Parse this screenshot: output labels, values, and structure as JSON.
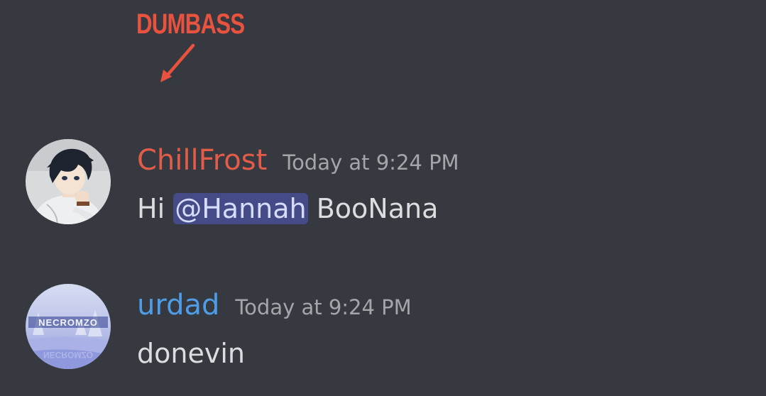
{
  "annotation": {
    "label": "DUMBASS",
    "color": "#e8523f"
  },
  "messages": [
    {
      "author": "ChillFrost",
      "author_color": "#e35c4a",
      "timestamp": "Today at 9:24 PM",
      "text_before": "Hi ",
      "mention": "@Hannah",
      "text_after": " BooNana",
      "avatar": "anime-boy-avatar"
    },
    {
      "author": "urdad",
      "author_color": "#4e9de6",
      "timestamp": "Today at 9:24 PM",
      "text": "donevin",
      "avatar": "necromzo-avatar",
      "avatar_text": "NECROMZO"
    }
  ]
}
